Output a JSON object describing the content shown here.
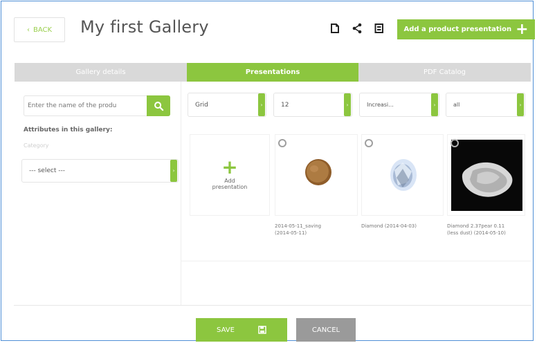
{
  "header": {
    "back_label": "BACK",
    "title": "My first Gallery",
    "add_button_label": "Add a product presentation",
    "icons": [
      "document-icon",
      "share-icon",
      "pdf-icon",
      "plus-icon"
    ]
  },
  "tabs": [
    {
      "label": "Gallery details",
      "active": false
    },
    {
      "label": "Presentations",
      "active": true
    },
    {
      "label": "PDF Catalog",
      "active": false
    }
  ],
  "left": {
    "search_placeholder": "Enter the name of the produ",
    "attributes_title": "Attributes in this gallery:",
    "category_label": "Category",
    "category_select": "--- select ---"
  },
  "filters": {
    "view": "Grid",
    "per_page": "12",
    "sort": "Increasi...",
    "scope": "all"
  },
  "gallery": {
    "add_label_line1": "Add",
    "add_label_line2": "presentation",
    "items": [
      {
        "caption_line1": "2014-05-11_saving",
        "caption_line2": "(2014-05-11)",
        "image": "coin"
      },
      {
        "caption_line1": "Diamond (2014-04-03)",
        "caption_line2": "",
        "image": "diamond"
      },
      {
        "caption_line1": "Diamond 2.37pear 0.11",
        "caption_line2": "(less dust) (2014-05-10)",
        "image": "pear"
      }
    ]
  },
  "footer": {
    "save_label": "SAVE",
    "cancel_label": "CANCEL"
  },
  "colors": {
    "accent": "#8cc63f",
    "tab_gray": "#d9d9d9",
    "cancel_gray": "#9a9a9a",
    "frame_blue": "#4f8fd6"
  }
}
